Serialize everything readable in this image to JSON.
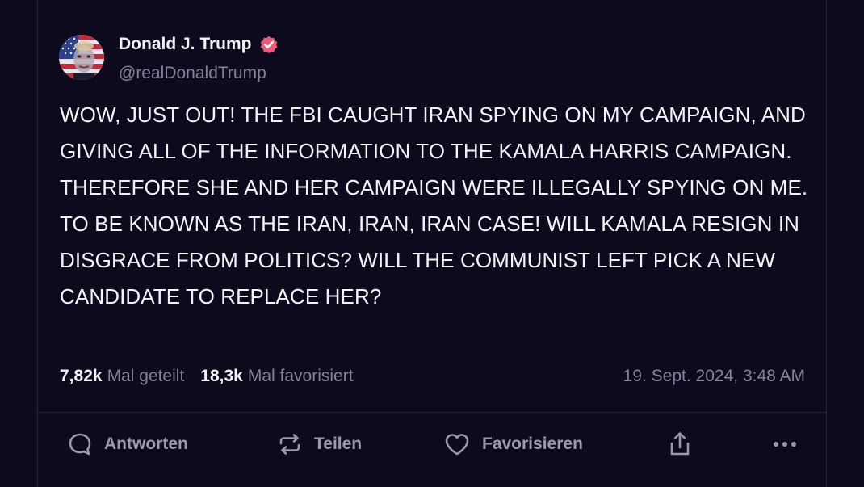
{
  "post": {
    "author_name": "Donald J. Trump",
    "author_handle": "@realDonaldTrump",
    "text": "WOW, JUST OUT! THE FBI CAUGHT IRAN SPYING ON MY CAMPAIGN, AND GIVING ALL OF THE INFORMATION TO THE KAMALA HARRIS CAMPAIGN. THEREFORE SHE AND HER CAMPAIGN WERE ILLEGALLY SPYING ON ME. TO BE KNOWN AS THE IRAN, IRAN, IRAN CASE! WILL KAMALA RESIGN IN DISGRACE FROM POLITICS? WILL THE COMMUNIST LEFT PICK A NEW CANDIDATE TO REPLACE HER?",
    "shares_count": "7,82k",
    "shares_label": "Mal geteilt",
    "favorites_count": "18,3k",
    "favorites_label": "Mal favorisiert",
    "timestamp": "19. Sept. 2024, 3:48 AM"
  },
  "actions": {
    "reply": "Antworten",
    "share": "Teilen",
    "favorite": "Favorisieren"
  },
  "icons": {
    "verified": "verified-badge-icon",
    "reply": "speech-bubble-icon",
    "share": "repost-icon",
    "favorite": "heart-icon",
    "export": "share-upload-icon",
    "more": "more-dots-icon"
  },
  "colors": {
    "background": "#0c0a1c",
    "text_primary": "#f4f4f8",
    "text_secondary": "#83829a",
    "verified_badge": "#f0597a",
    "border": "#25223a"
  }
}
